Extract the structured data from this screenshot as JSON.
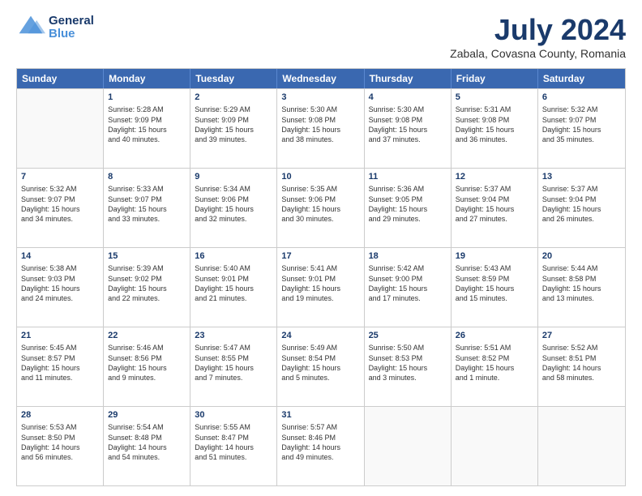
{
  "header": {
    "logo_general": "General",
    "logo_blue": "Blue",
    "title": "July 2024",
    "subtitle": "Zabala, Covasna County, Romania"
  },
  "calendar": {
    "days": [
      "Sunday",
      "Monday",
      "Tuesday",
      "Wednesday",
      "Thursday",
      "Friday",
      "Saturday"
    ],
    "rows": [
      [
        {
          "date": "",
          "empty": true
        },
        {
          "date": "1",
          "line1": "Sunrise: 5:28 AM",
          "line2": "Sunset: 9:09 PM",
          "line3": "Daylight: 15 hours",
          "line4": "and 40 minutes."
        },
        {
          "date": "2",
          "line1": "Sunrise: 5:29 AM",
          "line2": "Sunset: 9:09 PM",
          "line3": "Daylight: 15 hours",
          "line4": "and 39 minutes."
        },
        {
          "date": "3",
          "line1": "Sunrise: 5:30 AM",
          "line2": "Sunset: 9:08 PM",
          "line3": "Daylight: 15 hours",
          "line4": "and 38 minutes."
        },
        {
          "date": "4",
          "line1": "Sunrise: 5:30 AM",
          "line2": "Sunset: 9:08 PM",
          "line3": "Daylight: 15 hours",
          "line4": "and 37 minutes."
        },
        {
          "date": "5",
          "line1": "Sunrise: 5:31 AM",
          "line2": "Sunset: 9:08 PM",
          "line3": "Daylight: 15 hours",
          "line4": "and 36 minutes."
        },
        {
          "date": "6",
          "line1": "Sunrise: 5:32 AM",
          "line2": "Sunset: 9:07 PM",
          "line3": "Daylight: 15 hours",
          "line4": "and 35 minutes."
        }
      ],
      [
        {
          "date": "7",
          "line1": "Sunrise: 5:32 AM",
          "line2": "Sunset: 9:07 PM",
          "line3": "Daylight: 15 hours",
          "line4": "and 34 minutes."
        },
        {
          "date": "8",
          "line1": "Sunrise: 5:33 AM",
          "line2": "Sunset: 9:07 PM",
          "line3": "Daylight: 15 hours",
          "line4": "and 33 minutes."
        },
        {
          "date": "9",
          "line1": "Sunrise: 5:34 AM",
          "line2": "Sunset: 9:06 PM",
          "line3": "Daylight: 15 hours",
          "line4": "and 32 minutes."
        },
        {
          "date": "10",
          "line1": "Sunrise: 5:35 AM",
          "line2": "Sunset: 9:06 PM",
          "line3": "Daylight: 15 hours",
          "line4": "and 30 minutes."
        },
        {
          "date": "11",
          "line1": "Sunrise: 5:36 AM",
          "line2": "Sunset: 9:05 PM",
          "line3": "Daylight: 15 hours",
          "line4": "and 29 minutes."
        },
        {
          "date": "12",
          "line1": "Sunrise: 5:37 AM",
          "line2": "Sunset: 9:04 PM",
          "line3": "Daylight: 15 hours",
          "line4": "and 27 minutes."
        },
        {
          "date": "13",
          "line1": "Sunrise: 5:37 AM",
          "line2": "Sunset: 9:04 PM",
          "line3": "Daylight: 15 hours",
          "line4": "and 26 minutes."
        }
      ],
      [
        {
          "date": "14",
          "line1": "Sunrise: 5:38 AM",
          "line2": "Sunset: 9:03 PM",
          "line3": "Daylight: 15 hours",
          "line4": "and 24 minutes."
        },
        {
          "date": "15",
          "line1": "Sunrise: 5:39 AM",
          "line2": "Sunset: 9:02 PM",
          "line3": "Daylight: 15 hours",
          "line4": "and 22 minutes."
        },
        {
          "date": "16",
          "line1": "Sunrise: 5:40 AM",
          "line2": "Sunset: 9:01 PM",
          "line3": "Daylight: 15 hours",
          "line4": "and 21 minutes."
        },
        {
          "date": "17",
          "line1": "Sunrise: 5:41 AM",
          "line2": "Sunset: 9:01 PM",
          "line3": "Daylight: 15 hours",
          "line4": "and 19 minutes."
        },
        {
          "date": "18",
          "line1": "Sunrise: 5:42 AM",
          "line2": "Sunset: 9:00 PM",
          "line3": "Daylight: 15 hours",
          "line4": "and 17 minutes."
        },
        {
          "date": "19",
          "line1": "Sunrise: 5:43 AM",
          "line2": "Sunset: 8:59 PM",
          "line3": "Daylight: 15 hours",
          "line4": "and 15 minutes."
        },
        {
          "date": "20",
          "line1": "Sunrise: 5:44 AM",
          "line2": "Sunset: 8:58 PM",
          "line3": "Daylight: 15 hours",
          "line4": "and 13 minutes."
        }
      ],
      [
        {
          "date": "21",
          "line1": "Sunrise: 5:45 AM",
          "line2": "Sunset: 8:57 PM",
          "line3": "Daylight: 15 hours",
          "line4": "and 11 minutes."
        },
        {
          "date": "22",
          "line1": "Sunrise: 5:46 AM",
          "line2": "Sunset: 8:56 PM",
          "line3": "Daylight: 15 hours",
          "line4": "and 9 minutes."
        },
        {
          "date": "23",
          "line1": "Sunrise: 5:47 AM",
          "line2": "Sunset: 8:55 PM",
          "line3": "Daylight: 15 hours",
          "line4": "and 7 minutes."
        },
        {
          "date": "24",
          "line1": "Sunrise: 5:49 AM",
          "line2": "Sunset: 8:54 PM",
          "line3": "Daylight: 15 hours",
          "line4": "and 5 minutes."
        },
        {
          "date": "25",
          "line1": "Sunrise: 5:50 AM",
          "line2": "Sunset: 8:53 PM",
          "line3": "Daylight: 15 hours",
          "line4": "and 3 minutes."
        },
        {
          "date": "26",
          "line1": "Sunrise: 5:51 AM",
          "line2": "Sunset: 8:52 PM",
          "line3": "Daylight: 15 hours",
          "line4": "and 1 minute."
        },
        {
          "date": "27",
          "line1": "Sunrise: 5:52 AM",
          "line2": "Sunset: 8:51 PM",
          "line3": "Daylight: 14 hours",
          "line4": "and 58 minutes."
        }
      ],
      [
        {
          "date": "28",
          "line1": "Sunrise: 5:53 AM",
          "line2": "Sunset: 8:50 PM",
          "line3": "Daylight: 14 hours",
          "line4": "and 56 minutes."
        },
        {
          "date": "29",
          "line1": "Sunrise: 5:54 AM",
          "line2": "Sunset: 8:48 PM",
          "line3": "Daylight: 14 hours",
          "line4": "and 54 minutes."
        },
        {
          "date": "30",
          "line1": "Sunrise: 5:55 AM",
          "line2": "Sunset: 8:47 PM",
          "line3": "Daylight: 14 hours",
          "line4": "and 51 minutes."
        },
        {
          "date": "31",
          "line1": "Sunrise: 5:57 AM",
          "line2": "Sunset: 8:46 PM",
          "line3": "Daylight: 14 hours",
          "line4": "and 49 minutes."
        },
        {
          "date": "",
          "empty": true
        },
        {
          "date": "",
          "empty": true
        },
        {
          "date": "",
          "empty": true
        }
      ]
    ]
  }
}
